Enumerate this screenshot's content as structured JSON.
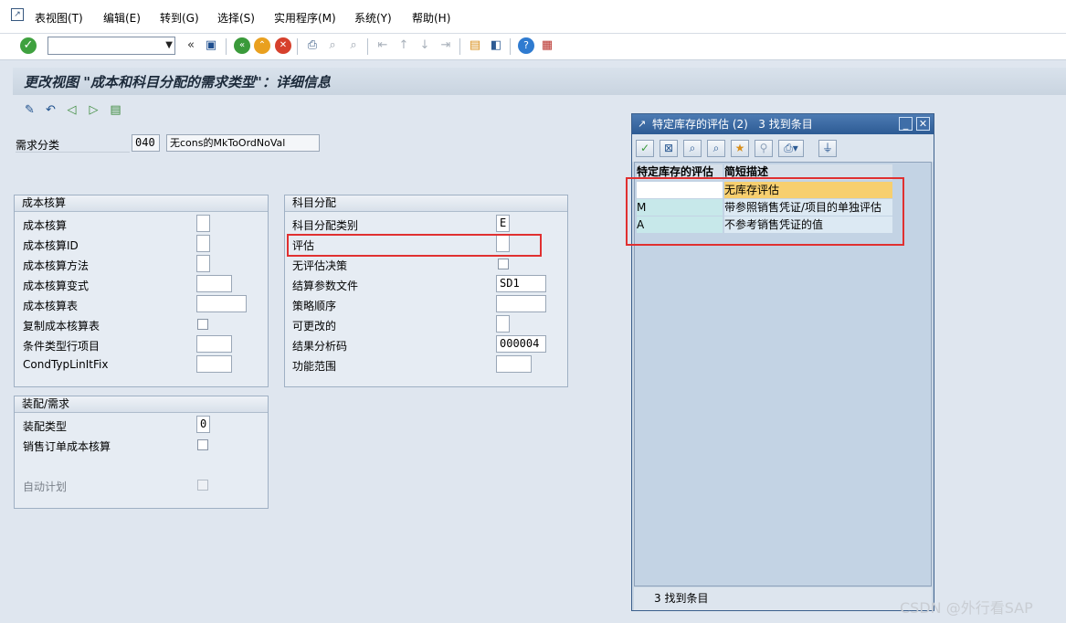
{
  "menu": [
    "表视图(T)",
    "编辑(E)",
    "转到(G)",
    "选择(S)",
    "实用程序(M)",
    "系统(Y)",
    "帮助(H)"
  ],
  "toolbar": {
    "command_value": "",
    "back_symbol": "«"
  },
  "page": {
    "title": "更改视图 \"成本和科目分配的需求类型\"：详细信息"
  },
  "requirement": {
    "label": "需求分类",
    "code": "040",
    "description": "无cons的MkToOrdNoVal"
  },
  "costing_group": {
    "title": "成本核算",
    "rows": [
      {
        "label": "成本核算",
        "value": ""
      },
      {
        "label": "成本核算ID",
        "value": ""
      },
      {
        "label": "成本核算方法",
        "value": ""
      },
      {
        "label": "成本核算变式",
        "value": ""
      },
      {
        "label": "成本核算表",
        "value": ""
      },
      {
        "label": "复制成本核算表",
        "value": ""
      },
      {
        "label": "条件类型行项目",
        "value": ""
      },
      {
        "label": "CondTypLinItFix",
        "value": ""
      }
    ]
  },
  "account_group": {
    "title": "科目分配",
    "rows": [
      {
        "label": "科目分配类别",
        "value": "E"
      },
      {
        "label": "评估",
        "value": ""
      },
      {
        "label": "无评估决策",
        "value": ""
      },
      {
        "label": "结算参数文件",
        "value": "SD1"
      },
      {
        "label": "策略顺序",
        "value": ""
      },
      {
        "label": "可更改的",
        "value": ""
      },
      {
        "label": "结果分析码",
        "value": "000004"
      },
      {
        "label": "功能范围",
        "value": ""
      }
    ]
  },
  "assembly_group": {
    "title": "装配/需求",
    "rows": [
      {
        "label": "装配类型",
        "value": "0"
      },
      {
        "label": "销售订单成本核算",
        "value": ""
      },
      {
        "label": "自动计划",
        "value": ""
      }
    ]
  },
  "popup": {
    "title": "特定库存的评估 (2)   3 找到条目",
    "columns": [
      "特定库存的评估",
      "简短描述"
    ],
    "rows": [
      {
        "key": "",
        "text": "无库存评估"
      },
      {
        "key": "M",
        "text": "带参照销售凭证/项目的单独评估"
      },
      {
        "key": "A",
        "text": "不参考销售凭证的值"
      }
    ],
    "status": "3 找到条目"
  },
  "watermark": "CSDN @外行看SAP",
  "colors": {
    "highlight": "#e03030",
    "selected_row": "#f7cf6f",
    "popup_title": "#2d5b94"
  }
}
